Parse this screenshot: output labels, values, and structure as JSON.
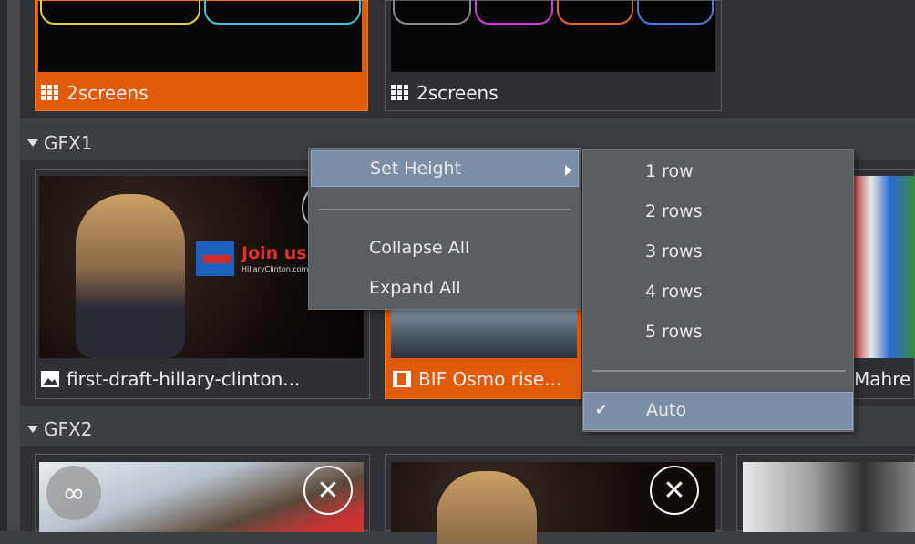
{
  "top_row": {
    "card_left": {
      "label": "2screens",
      "icon": "grid-icon",
      "selected": true
    },
    "card_right": {
      "label": "2screens",
      "icon": "grid-icon",
      "selected": false
    }
  },
  "gfx1": {
    "title": "GFX1",
    "cards": [
      {
        "label": "first-draft-hillary-clinton...",
        "icon": "image-icon",
        "overlay_text": "Join us",
        "overlay_sub": "HillaryClinton.com/..."
      },
      {
        "label": "BIF Osmo rise...",
        "icon": "film-icon",
        "selected": true
      },
      {
        "label": "Mahre",
        "icon": ""
      }
    ]
  },
  "gfx2": {
    "title": "GFX2",
    "cards": [
      {
        "icon": "infinity-icon",
        "close": "close-icon"
      },
      {
        "close": "close-icon"
      },
      {}
    ]
  },
  "context_menu": {
    "items": [
      "Set Height",
      "Collapse All",
      "Expand All"
    ],
    "submenu_arrow": "chevron-right-icon"
  },
  "submenu": {
    "items": [
      "1 row",
      "2 rows",
      "3 rows",
      "4 rows",
      "5 rows"
    ],
    "auto": "Auto",
    "checkmark": "✔"
  },
  "colors": {
    "accent": "#e05a0a",
    "menu_bg": "#5a5d61",
    "highlight": "#7a8ea8"
  }
}
